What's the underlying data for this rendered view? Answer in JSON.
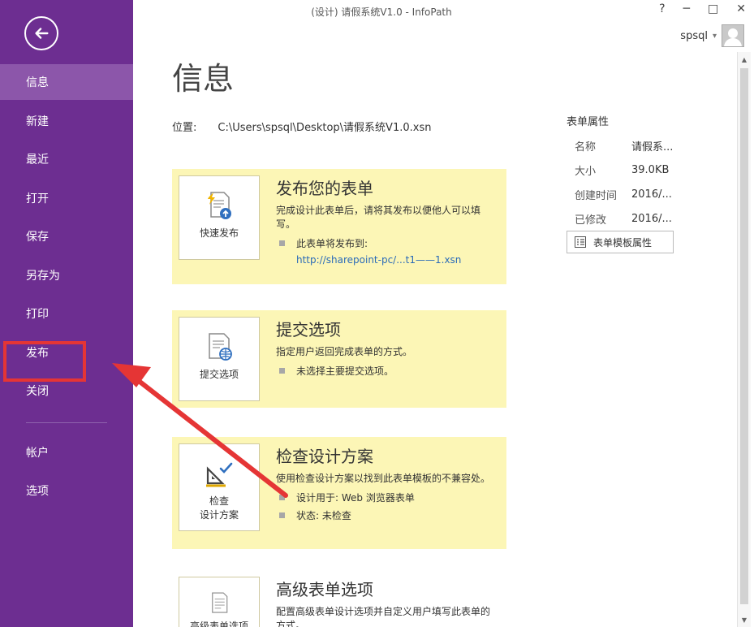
{
  "window": {
    "title": "(设计) 请假系统V1.0 - InfoPath",
    "help": "?",
    "minimize": "─",
    "restore": "□",
    "close": "✕"
  },
  "user": {
    "name": "spsql",
    "dropdown": "▾"
  },
  "sidebar": {
    "items": [
      {
        "label": "信息"
      },
      {
        "label": "新建"
      },
      {
        "label": "最近"
      },
      {
        "label": "打开"
      },
      {
        "label": "保存"
      },
      {
        "label": "另存为"
      },
      {
        "label": "打印"
      },
      {
        "label": "发布"
      },
      {
        "label": "关闭"
      },
      {
        "label": "帐户"
      },
      {
        "label": "选项"
      }
    ]
  },
  "main": {
    "title": "信息",
    "location": {
      "label": "位置:",
      "path": "C:\\Users\\spsql\\Desktop\\请假系统V1.0.xsn"
    },
    "cards": [
      {
        "icon_label": "快速发布",
        "title": "发布您的表单",
        "desc": "完成设计此表单后，请将其发布以便他人可以填写。",
        "bullets": [
          "此表单将发布到:"
        ],
        "link": "http://sharepoint-pc/...t1——1.xsn"
      },
      {
        "icon_label": "提交选项",
        "title": "提交选项",
        "desc": "指定用户返回完成表单的方式。",
        "bullets": [
          "未选择主要提交选项。"
        ]
      },
      {
        "icon_label_1": "检查",
        "icon_label_2": "设计方案",
        "title": "检查设计方案",
        "desc": "使用检查设计方案以找到此表单模板的不兼容处。",
        "bullets": [
          "设计用于: Web 浏览器表单",
          "状态: 未检查"
        ]
      },
      {
        "icon_label": "高级表单选项",
        "title": "高级表单选项",
        "desc": "配置高级表单设计选项并自定义用户填写此表单的方式。"
      }
    ]
  },
  "properties": {
    "title": "表单属性",
    "rows": [
      {
        "label": "名称",
        "value": "请假系..."
      },
      {
        "label": "大小",
        "value": "39.0KB"
      },
      {
        "label": "创建时间",
        "value": "2016/..."
      },
      {
        "label": "已修改",
        "value": "2016/..."
      }
    ],
    "button": "表单模板属性"
  },
  "colors": {
    "sidebar": "#6d2e91",
    "active": "#8c56aa",
    "card": "#fcf6b6",
    "annotation": "#e53535",
    "link": "#2a6bb8"
  }
}
